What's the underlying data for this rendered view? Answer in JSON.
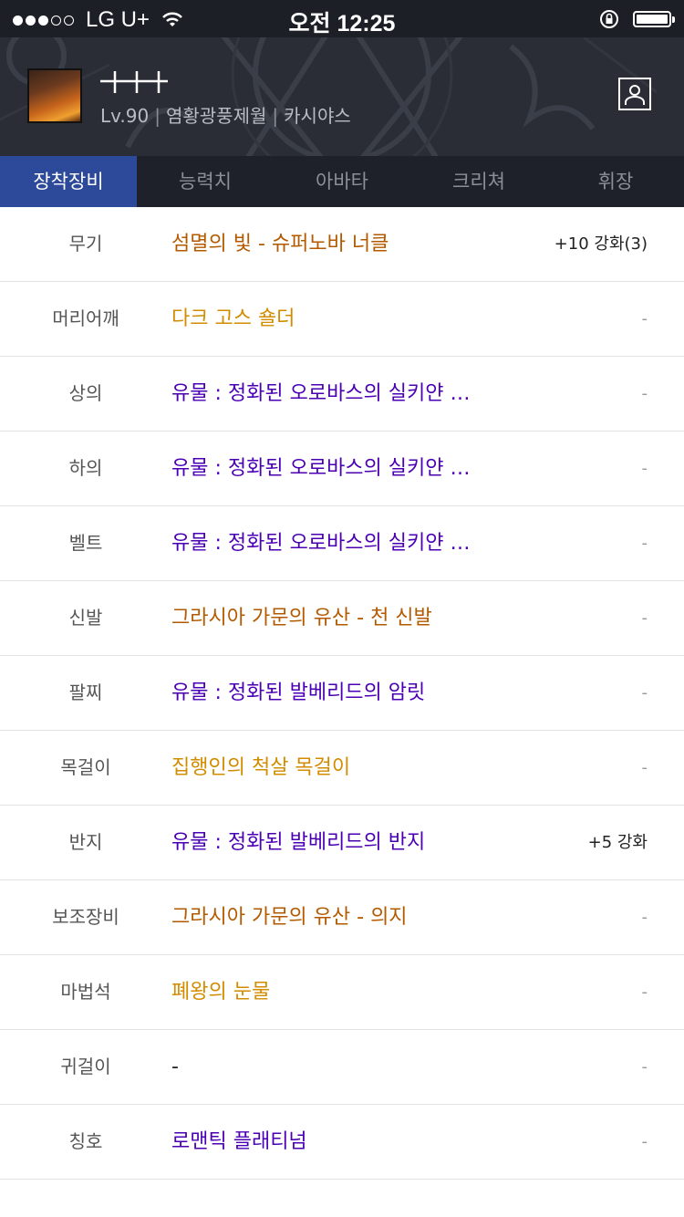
{
  "status_bar": {
    "carrier": "LG U+",
    "time": "오전 12:25",
    "signal_icon": "signal-dots-icon",
    "wifi_icon": "wifi-icon",
    "lock_icon": "rotation-lock-icon",
    "battery_icon": "battery-icon"
  },
  "profile": {
    "name_glyph_icon": "character-name-glyph-icon",
    "level": "Lv.90",
    "job": "염황광풍제월",
    "server": "카시야스",
    "user_icon": "user-profile-icon"
  },
  "tabs": [
    {
      "label": "장착장비",
      "active": true
    },
    {
      "label": "능력치",
      "active": false
    },
    {
      "label": "아바타",
      "active": false
    },
    {
      "label": "크리쳐",
      "active": false
    },
    {
      "label": "휘장",
      "active": false
    }
  ],
  "colors": {
    "epic": "#b35a00",
    "unique": "#d28c00",
    "legendary": "#4b00b4",
    "tab_active": "#2d4a9a",
    "header_bg": "#2a2d35"
  },
  "equipment": [
    {
      "slot": "무기",
      "item": "섬멸의 빛 - 슈퍼노바 너클",
      "rarity": "epic",
      "enhance": "+10 강화(3)"
    },
    {
      "slot": "머리어깨",
      "item": "다크 고스 숄더",
      "rarity": "unique",
      "enhance": "-"
    },
    {
      "slot": "상의",
      "item": "유물 : 정화된 오로바스의 실키얀 …",
      "rarity": "legend",
      "enhance": "-"
    },
    {
      "slot": "하의",
      "item": "유물 : 정화된 오로바스의 실키얀 …",
      "rarity": "legend",
      "enhance": "-"
    },
    {
      "slot": "벨트",
      "item": "유물 : 정화된 오로바스의 실키얀 …",
      "rarity": "legend",
      "enhance": "-"
    },
    {
      "slot": "신발",
      "item": "그라시아 가문의 유산 - 천 신발",
      "rarity": "epic",
      "enhance": "-"
    },
    {
      "slot": "팔찌",
      "item": "유물 : 정화된 발베리드의 암릿",
      "rarity": "legend",
      "enhance": "-"
    },
    {
      "slot": "목걸이",
      "item": "집행인의 척살 목걸이",
      "rarity": "unique",
      "enhance": "-"
    },
    {
      "slot": "반지",
      "item": "유물 : 정화된 발베리드의 반지",
      "rarity": "legend",
      "enhance": "+5 강화"
    },
    {
      "slot": "보조장비",
      "item": "그라시아 가문의 유산 - 의지",
      "rarity": "epic",
      "enhance": "-"
    },
    {
      "slot": "마법석",
      "item": "폐왕의 눈물",
      "rarity": "unique",
      "enhance": "-"
    },
    {
      "slot": "귀걸이",
      "item": "-",
      "rarity": "none",
      "enhance": "-"
    },
    {
      "slot": "칭호",
      "item": "로맨틱 플래티넘",
      "rarity": "legend",
      "enhance": "-"
    }
  ]
}
